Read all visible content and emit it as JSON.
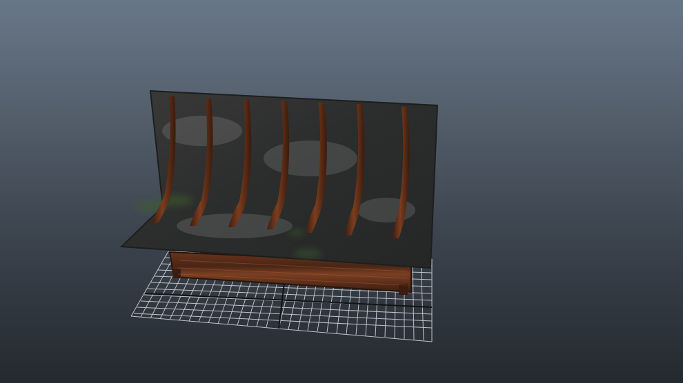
{
  "viewport": {
    "background_top": "#687788",
    "background_bottom": "#24292f",
    "grid_color": "#d8dde3",
    "axis_color": "#101214"
  },
  "model": {
    "roof_color": "#2f3131",
    "wood_color": "#5a2c18",
    "moss_color": "#3d5f2d",
    "rafter_count": 7
  }
}
